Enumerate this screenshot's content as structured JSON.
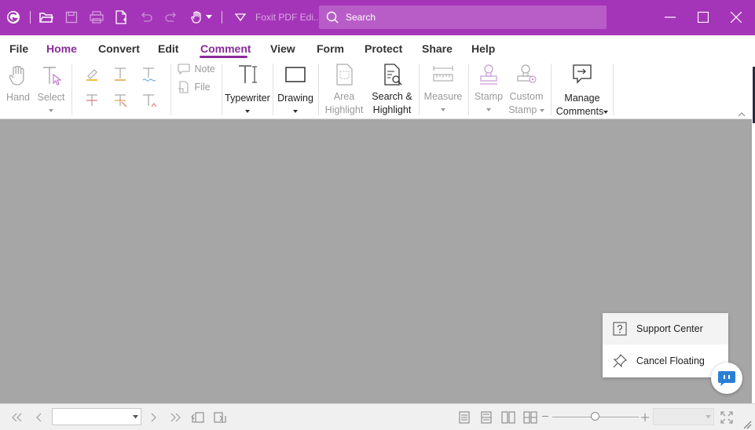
{
  "titlebar": {
    "app_title": "Foxit PDF Edi...",
    "search_placeholder": "Search",
    "bg_color": "#a535b8"
  },
  "menu": {
    "items": [
      "File",
      "Home",
      "Convert",
      "Edit",
      "Comment",
      "View",
      "Form",
      "Protect",
      "Share",
      "Help"
    ],
    "active": "Comment"
  },
  "ribbon": {
    "hand": "Hand",
    "select": "Select",
    "note": "Note",
    "file": "File",
    "typewriter": "Typewriter",
    "drawing": "Drawing",
    "area_highlight_1": "Area",
    "area_highlight_2": "Highlight",
    "search_highlight_1": "Search &",
    "search_highlight_2": "Highlight",
    "measure": "Measure",
    "stamp": "Stamp",
    "custom_stamp_1": "Custom",
    "custom_stamp_2": "Stamp",
    "manage_comments_1": "Manage",
    "manage_comments_2": "Comments"
  },
  "popup": {
    "support_center": "Support Center",
    "cancel_floating": "Cancel Floating"
  },
  "statusbar": {
    "page_value": "",
    "zoom_value": ""
  },
  "colors": {
    "accent": "#8a2b9b",
    "doc_bg": "#a6a6a6"
  }
}
